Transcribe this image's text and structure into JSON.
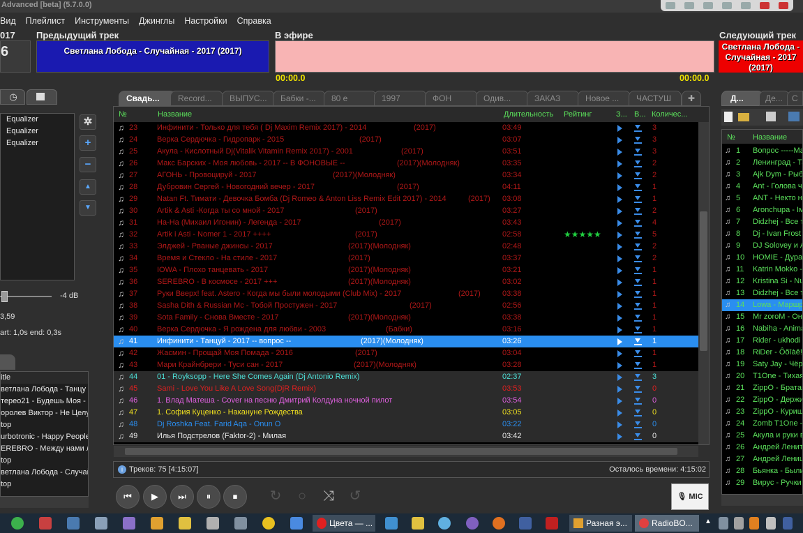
{
  "window": {
    "title": "Advanced [beta] (5.7.0.0)"
  },
  "menu": [
    "Вид",
    "Плейлист",
    "Инструменты",
    "Джинглы",
    "Настройки",
    "Справка"
  ],
  "header": {
    "left_year": "017",
    "left_num": "6",
    "prev_label": "Предыдущий трек",
    "prev_track": "Светлана Лобода - Случайная - 2017 (2017)",
    "onair_label": "В эфире",
    "onair_time_left": "00:00.0",
    "onair_time_right": "00:00.0",
    "next_label": "Следующий трек",
    "next_track_1": "Светлана Лобода -",
    "next_track_2": "Случайная - 2017",
    "next_track_3": "(2017)"
  },
  "left_panel": {
    "eq_items": [
      "Equalizer",
      "Equalizer",
      "Equalizer"
    ],
    "db_value": "-4 dB",
    "value_359": "3,59",
    "start_end": "art: 1,0s end: 0,3s",
    "history_header": "itle",
    "history": [
      "ветлана Лобода - Танцу",
      "терео21 - Будешь Моя - 2",
      "оролев Виктор - Не Целу",
      "top",
      "urbotronic - Happy People",
      "EREBRO - Между нами лю",
      "top",
      "ветлана Лобода - Случай",
      "top"
    ]
  },
  "tabs": [
    "Свадь...",
    "Record...",
    "ВЫПУС...",
    "Бабки -...",
    "80 е",
    "1997",
    "ФОН",
    "Одив...",
    "ЗАКАЗ",
    "Новое ...",
    "ЧАСТУШ"
  ],
  "columns": {
    "num": "№",
    "name": "Название",
    "duration": "Длительность",
    "rating": "Рейтинг",
    "z": "З...",
    "v": "В...",
    "count": "Количес..."
  },
  "rows": [
    {
      "num": "23",
      "name": "Инфинити - Только для тебя ( Dj Maxim Remix 2017) - 2014",
      "tag": "(2017)",
      "dur": "03:49",
      "cnt": "3",
      "color": "#b01818",
      "rating": ""
    },
    {
      "num": "24",
      "name": "Верка Сердючка - Гидропарк - 2015",
      "tag": "(2017)",
      "dur": "03:07",
      "cnt": "3",
      "color": "#b01818",
      "rating": ""
    },
    {
      "num": "25",
      "name": "Акула - Кислотный Dj(Vitalik Vitamin Remix 2017) - 2001",
      "tag": "(2017)",
      "dur": "03:51",
      "cnt": "3",
      "color": "#b01818",
      "rating": ""
    },
    {
      "num": "26",
      "name": "Макс Барских - Моя любовь - 2017 -- В ФОНОВЫЕ --",
      "tag": "(2017)(Молодняк)",
      "dur": "03:35",
      "cnt": "2",
      "color": "#b01818",
      "rating": ""
    },
    {
      "num": "27",
      "name": "АГОНЬ - Провоцируй - 2017",
      "tag": "(2017)(Молодняк)",
      "dur": "03:34",
      "cnt": "2",
      "color": "#b01818",
      "rating": ""
    },
    {
      "num": "28",
      "name": "Дубровин Сергей - Новогодний вечер - 2017",
      "tag": "(2017)",
      "dur": "04:11",
      "cnt": "1",
      "color": "#b01818",
      "rating": ""
    },
    {
      "num": "29",
      "name": "Natan Ft. Тимати - Девочка Бомба (Dj Romeo & Anton Liss Remix Edit 2017) - 2014",
      "tag": "(2017)",
      "dur": "03:08",
      "cnt": "1",
      "color": "#b01818",
      "rating": ""
    },
    {
      "num": "30",
      "name": "Artik & Asti -Когда ты со мной - 2017",
      "tag": "(2017)",
      "dur": "03:27",
      "cnt": "2",
      "color": "#b01818",
      "rating": ""
    },
    {
      "num": "31",
      "name": "На-На (Михаил Игонин) - Легенда - 2017",
      "tag": "(2017)",
      "dur": "03:43",
      "cnt": "4",
      "color": "#b01818",
      "rating": ""
    },
    {
      "num": "32",
      "name": "Artik i Asti - Nomer 1 - 2017 ++++",
      "tag": "(2017)",
      "dur": "02:58",
      "cnt": "5",
      "color": "#b01818",
      "rating": "★★★★★"
    },
    {
      "num": "33",
      "name": "Элджей - Рваные джинсы - 2017",
      "tag": "(2017)(Молодняк)",
      "dur": "02:48",
      "cnt": "2",
      "color": "#b01818",
      "rating": ""
    },
    {
      "num": "34",
      "name": "Время и Стекло - На стиле - 2017",
      "tag": "(2017)",
      "dur": "03:37",
      "cnt": "2",
      "color": "#b01818",
      "rating": ""
    },
    {
      "num": "35",
      "name": "IOWA - Плохо танцевать - 2017",
      "tag": "(2017)(Молодняк)",
      "dur": "03:21",
      "cnt": "1",
      "color": "#b01818",
      "rating": ""
    },
    {
      "num": "36",
      "name": "SEREBRO - В космосе - 2017 +++",
      "tag": "(2017)(Молодняк)",
      "dur": "03:02",
      "cnt": "1",
      "color": "#b01818",
      "rating": ""
    },
    {
      "num": "37",
      "name": "Руки Вверх! feat. Astero - Когда мы были молодыми (Club Mix) - 2017",
      "tag": "(2017)",
      "dur": "03:38",
      "cnt": "1",
      "color": "#b01818",
      "rating": ""
    },
    {
      "num": "38",
      "name": "Sasha Dith & Russian Mc - Тобой Простужен - 2017",
      "tag": "(2017)",
      "dur": "02:56",
      "cnt": "1",
      "color": "#b01818",
      "rating": ""
    },
    {
      "num": "39",
      "name": "Sota Family - Снова Вместе - 2017",
      "tag": "(2017)(Молодняк)",
      "dur": "03:38",
      "cnt": "1",
      "color": "#b01818",
      "rating": ""
    },
    {
      "num": "40",
      "name": "Верка Сердючка - Я рождена для любви - 2003",
      "tag": "(Бабки)",
      "dur": "03:16",
      "cnt": "1",
      "color": "#b01818",
      "rating": ""
    },
    {
      "num": "41",
      "name": "Инфинити - Танцуй - 2017 -- вопрос --",
      "tag": "(2017)(Молодняк)",
      "dur": "03:26",
      "cnt": "1",
      "color": "#ffffff",
      "rating": "",
      "selected": true
    },
    {
      "num": "42",
      "name": "Жасмин - Прощай Моя Помада - 2016",
      "tag": "(2017)",
      "dur": "03:04",
      "cnt": "1",
      "color": "#b01818",
      "rating": ""
    },
    {
      "num": "43",
      "name": "Мари Крайнбрери - Туси сан - 2017",
      "tag": "(2017)(Молодняк)",
      "dur": "03:28",
      "cnt": "1",
      "color": "#b01818",
      "rating": ""
    },
    {
      "num": "44",
      "name": "01 - Royksopp - Here She Comes Again (Dj Antonio Remix)",
      "tag": "",
      "dur": "02:37",
      "cnt": "3",
      "color": "#4de0d8",
      "rating": "",
      "grey": true
    },
    {
      "num": "45",
      "name": "Sami - Love You Like A Love Song(DjR Remix)",
      "tag": "",
      "dur": "03:53",
      "cnt": "0",
      "color": "#e02020",
      "rating": "",
      "grey": true
    },
    {
      "num": "46",
      "name": "1. Влад Матеша - Cover на песню Дмитрий Колдуна ночной пилот",
      "tag": "",
      "dur": "03:54",
      "cnt": "0",
      "color": "#e060e0",
      "rating": "",
      "grey": true
    },
    {
      "num": "47",
      "name": "1. София Куценко - Накануне Рождества",
      "tag": "",
      "dur": "03:05",
      "cnt": "0",
      "color": "#f0e020",
      "rating": "",
      "grey": true
    },
    {
      "num": "48",
      "name": "Dj Roshka Feat. Farid Aqa - Onun O",
      "tag": "",
      "dur": "03:22",
      "cnt": "0",
      "color": "#2a8ef0",
      "rating": "",
      "grey": true
    },
    {
      "num": "49",
      "name": "Илья Подстрелов (Faktor-2) - Милая",
      "tag": "",
      "dur": "03:42",
      "cnt": "0",
      "color": "#e8e8e8",
      "rating": "",
      "grey": true
    }
  ],
  "status": {
    "tracks": "Треков: 75 [4:15:07]",
    "remaining": "Осталось времени: 4:15:02"
  },
  "transport": {
    "prev": "⏮",
    "play": "▶",
    "next": "⏭",
    "pause": "⏸",
    "stop": "⏹",
    "mic": "MIC"
  },
  "right_panel": {
    "tabs": [
      "Д...",
      "Де...",
      "С"
    ],
    "col_num": "№",
    "col_name": "Название",
    "rows": [
      {
        "num": "1",
        "name": "Вопрос -----Ма"
      },
      {
        "num": "2",
        "name": "Ленинград - Та"
      },
      {
        "num": "3",
        "name": "Ajk Dym - Рыба"
      },
      {
        "num": "4",
        "name": "Ant - Голова ч"
      },
      {
        "num": "5",
        "name": "ANT - Некто не"
      },
      {
        "num": "6",
        "name": "Aronchupa - Ім"
      },
      {
        "num": "7",
        "name": "Didzhej - Все т"
      },
      {
        "num": "8",
        "name": "Dj - Ivan Frost"
      },
      {
        "num": "9",
        "name": "DJ Solovey и A"
      },
      {
        "num": "10",
        "name": "HOMIE - Дура"
      },
      {
        "num": "11",
        "name": "Katrin Mokko -"
      },
      {
        "num": "12",
        "name": "Kristina Si - Nu"
      },
      {
        "num": "13",
        "name": "Didzhej - Все т"
      },
      {
        "num": "14",
        "name": "Lowa - Маршр",
        "selected": true
      },
      {
        "num": "15",
        "name": "Mr zoroM - Она"
      },
      {
        "num": "16",
        "name": "Nabiha - Anima"
      },
      {
        "num": "17",
        "name": "Rider - ukhodi r"
      },
      {
        "num": "18",
        "name": "RiDer - Ôõîàê!"
      },
      {
        "num": "19",
        "name": "Saty Jay - Чёр"
      },
      {
        "num": "20",
        "name": "T1One - Тихая"
      },
      {
        "num": "21",
        "name": "ZippO - Братан"
      },
      {
        "num": "22",
        "name": "ZippO - Держи"
      },
      {
        "num": "23",
        "name": "ZippO - Курищ"
      },
      {
        "num": "24",
        "name": "Zomb T1One -"
      },
      {
        "num": "25",
        "name": "Акула и руки в"
      },
      {
        "num": "26",
        "name": "Андрей Ленит"
      },
      {
        "num": "27",
        "name": "Андрей Лениц"
      },
      {
        "num": "28",
        "name": "Бьянка - Были"
      },
      {
        "num": "29",
        "name": "Вирус - Ручки"
      }
    ]
  },
  "taskbar": {
    "task1": "Цвета — ...",
    "task2": "Разная э...",
    "task3": "RadioBO..."
  }
}
